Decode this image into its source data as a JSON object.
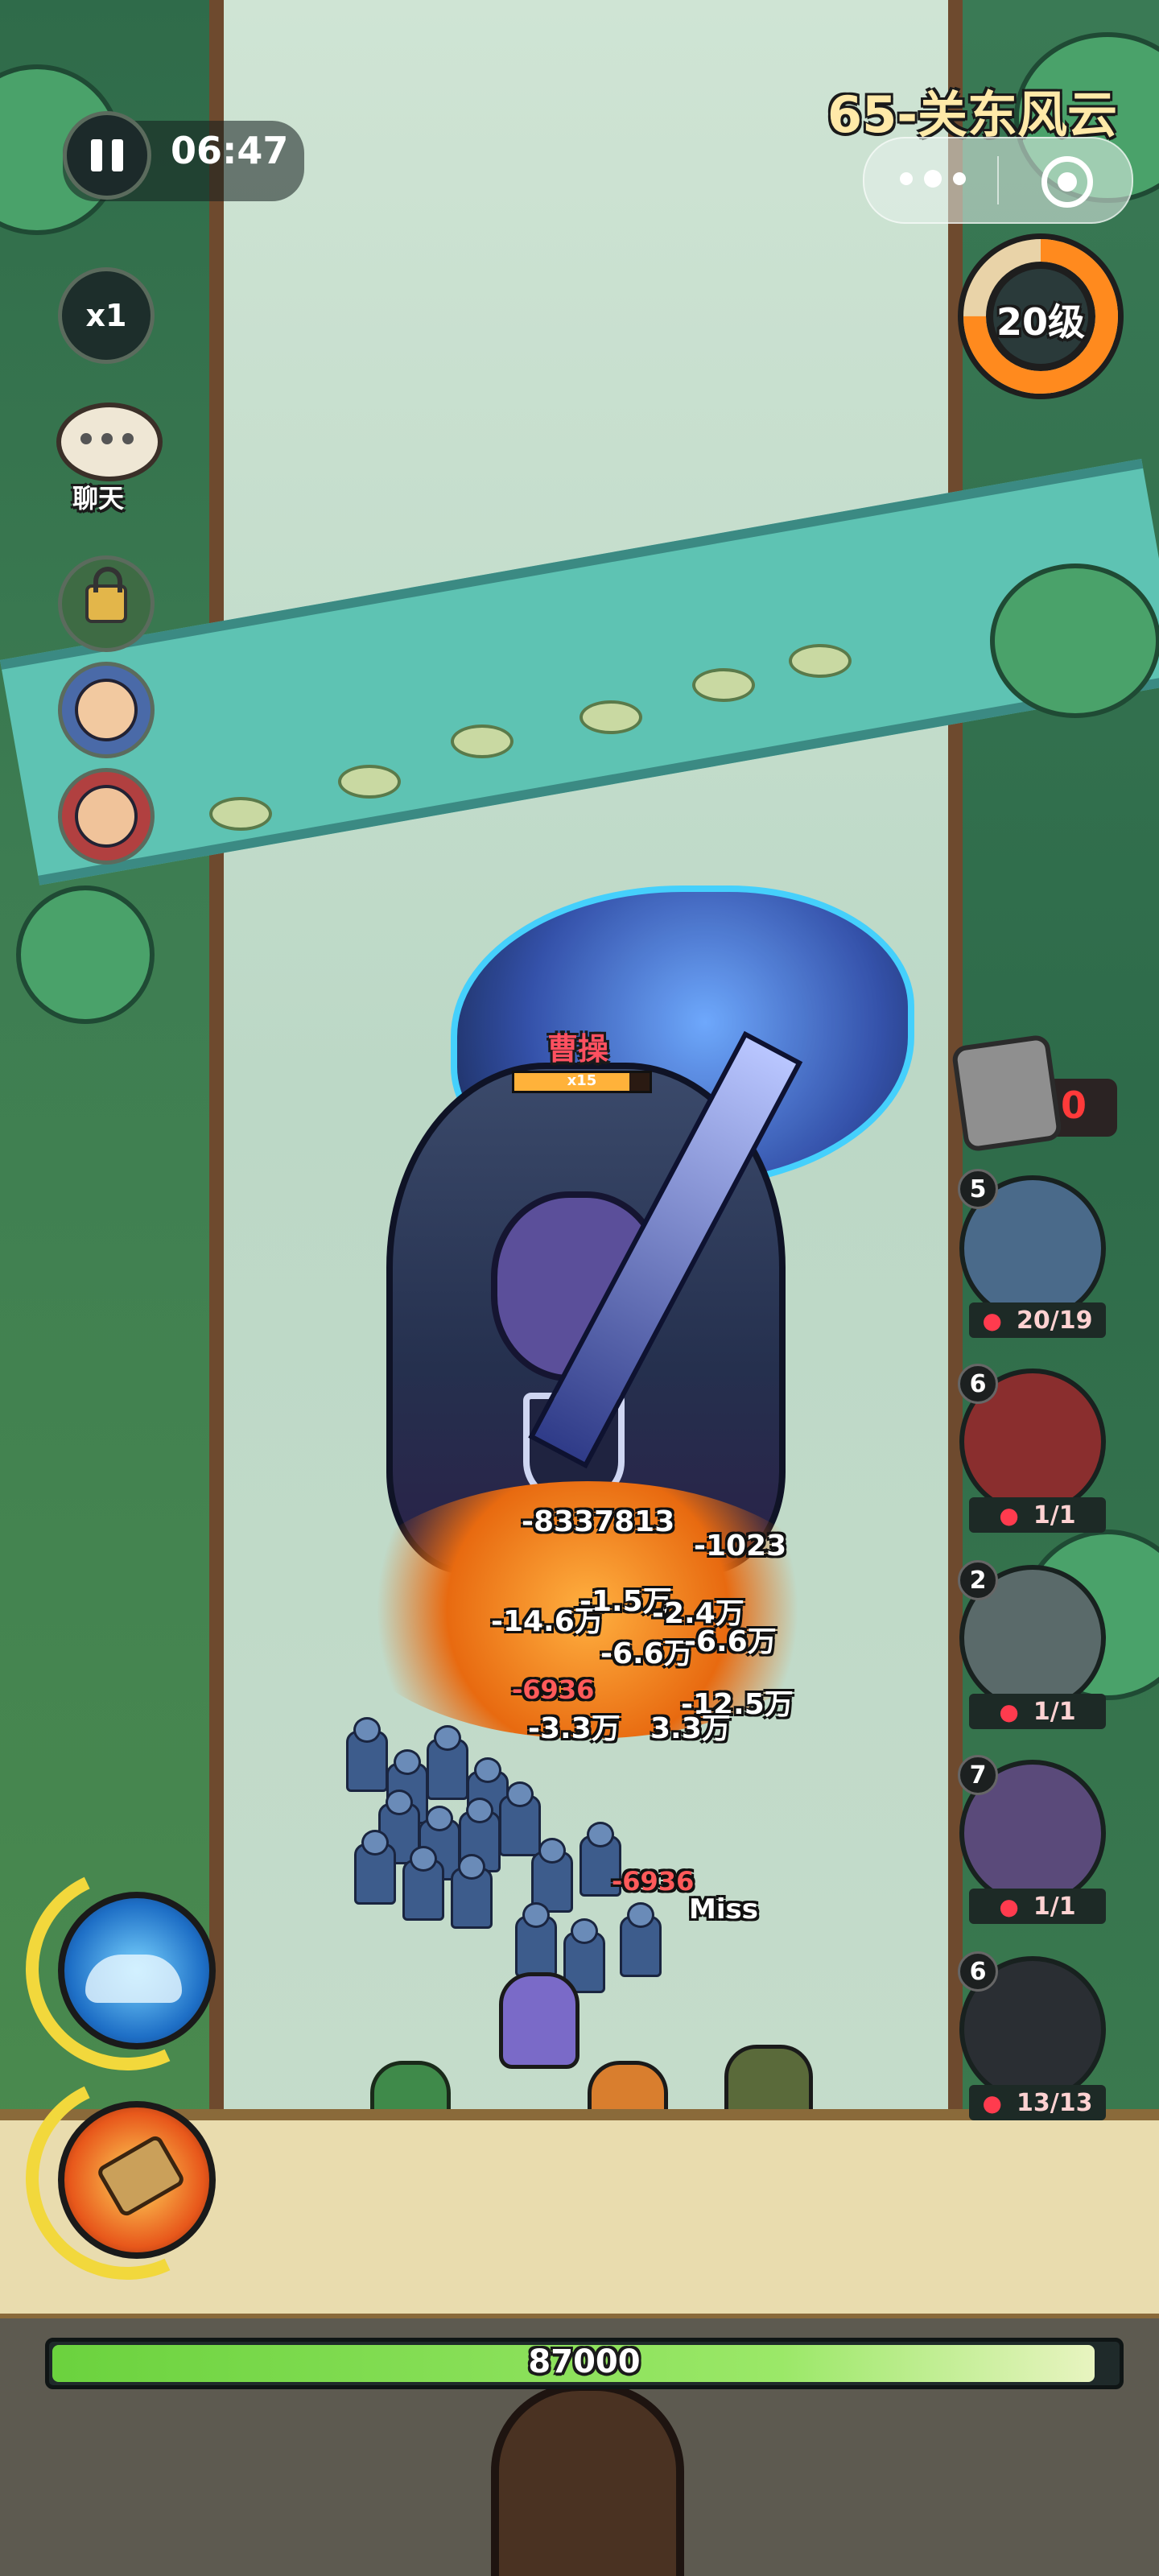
{
  "top_left": {
    "pause_icon": "pause-icon",
    "timer": "06:47",
    "speed": "x1"
  },
  "chat": {
    "label": "聊天",
    "icon": "chat-bubble-icon"
  },
  "stage": {
    "title": "65-关东风云"
  },
  "miniprogram": {
    "menu_icon": "more-dots-icon",
    "close_icon": "target-close-icon"
  },
  "level_badge": {
    "label": "20级",
    "progress": 0.75
  },
  "boss": {
    "name": "曹操",
    "stack": "x15",
    "hp_fraction": 0.85
  },
  "resource": {
    "icon": "token-icon",
    "count": "0"
  },
  "units": [
    {
      "level": "5",
      "count": "20/19"
    },
    {
      "level": "6",
      "count": "1/1"
    },
    {
      "level": "2",
      "count": "1/1"
    },
    {
      "level": "7",
      "count": "1/1"
    },
    {
      "level": "6",
      "count": "13/13"
    }
  ],
  "damage_numbers": [
    "-8337813",
    "-1023",
    "-14.6万",
    "-1.5万",
    "-2.4万",
    "-6.6万",
    "-6.6万",
    "-6936",
    "-12.5万",
    "-3.3万",
    "3.3万",
    "-6936",
    "Miss"
  ],
  "skills": [
    {
      "icon": "wave-skill-icon"
    },
    {
      "icon": "hammer-skill-icon"
    }
  ],
  "wall_hp": {
    "value": "87000",
    "fraction": 0.98
  },
  "colors": {
    "hp_green": "#8fe05a",
    "level_orange": "#ff8a1e",
    "damage_red": "#ff5a5a"
  }
}
